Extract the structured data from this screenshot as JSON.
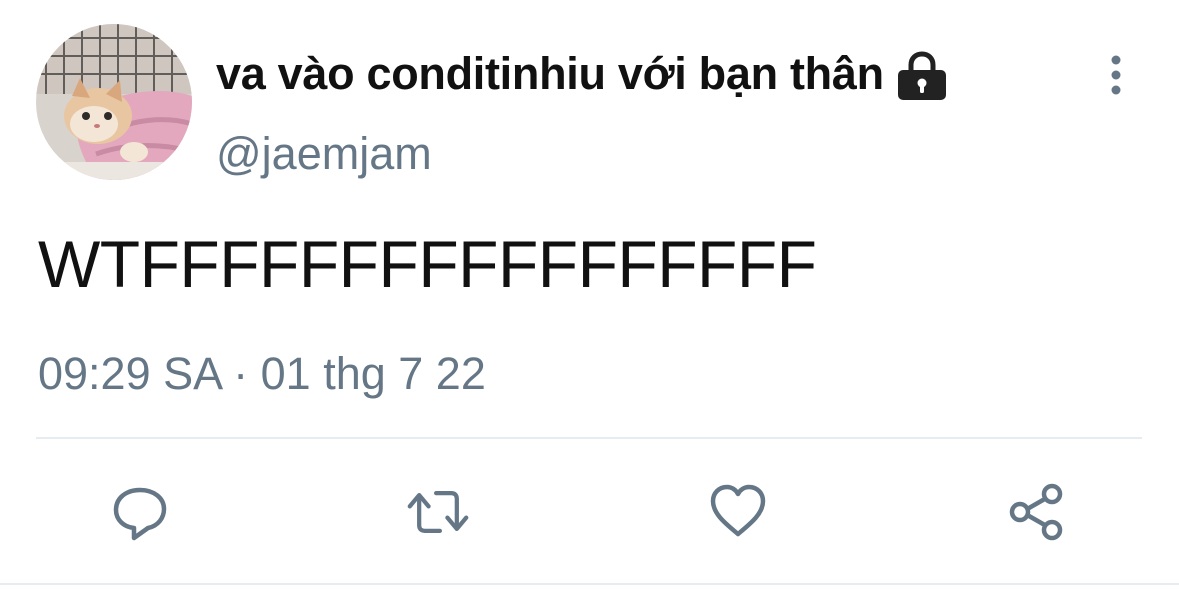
{
  "tweet": {
    "display_name": "va vào conditinhiu với bạn thân",
    "handle": "@jaemjam",
    "text": "WTFFFFFFFFFFFFFFFFF",
    "timestamp": "09:29 SA · 01 thg 7 22"
  },
  "icons": {
    "avatar": "cat-in-pink-blanket-photo",
    "protected": "lock-icon",
    "more": "more-vertical-icon",
    "reply": "reply-icon",
    "retweet": "retweet-icon",
    "like": "heart-icon",
    "share": "share-icon"
  },
  "colors": {
    "text_primary": "#111111",
    "text_secondary": "#657786",
    "divider": "#e6ecf0",
    "icon": "#657786"
  }
}
